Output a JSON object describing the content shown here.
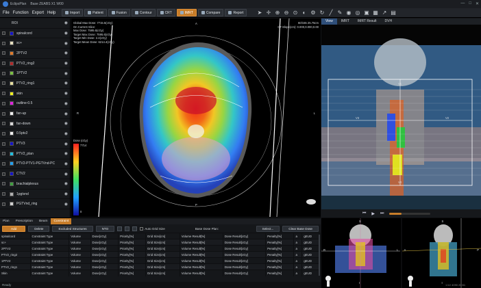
{
  "app": {
    "name": "EclipsPlan",
    "subtitle": "Base  ZEABS X1 W00",
    "window_controls": [
      "—",
      "□",
      "✕"
    ]
  },
  "menu": [
    "File",
    "Function",
    "Export",
    "Help"
  ],
  "toolbar_buttons": [
    {
      "label": "Import",
      "active": false
    },
    {
      "label": "Patient",
      "active": false
    },
    {
      "label": "Fusion",
      "active": false
    },
    {
      "label": "Contour",
      "active": false
    },
    {
      "label": "CRT",
      "active": false
    },
    {
      "label": "IMRT",
      "active": true
    },
    {
      "label": "Compare",
      "active": false
    },
    {
      "label": "Report",
      "active": false
    }
  ],
  "tools": [
    {
      "name": "pointer-icon",
      "glyph": "➤"
    },
    {
      "name": "move-icon",
      "glyph": "✛"
    },
    {
      "name": "zoom-in-icon",
      "glyph": "⊕"
    },
    {
      "name": "zoom-out-icon",
      "glyph": "⊖"
    },
    {
      "name": "zoom-fit-icon",
      "glyph": "⊙"
    },
    {
      "name": "window-level-icon",
      "glyph": "◐"
    },
    {
      "name": "settings-icon",
      "glyph": "⚙"
    },
    {
      "name": "rotate-icon",
      "glyph": "↻"
    },
    {
      "name": "ruler-icon",
      "glyph": "╱"
    },
    {
      "name": "brush-icon",
      "glyph": "✎"
    },
    {
      "name": "dose-icon",
      "glyph": "◉"
    },
    {
      "name": "contour-icon",
      "glyph": "◎"
    },
    {
      "name": "lock-icon",
      "glyph": "▣"
    },
    {
      "name": "camera-icon",
      "glyph": "▦"
    },
    {
      "name": "export-icon",
      "glyph": "↗"
    },
    {
      "name": "screenshot-icon",
      "glyph": "▤"
    }
  ],
  "roi": {
    "header": "ROI",
    "items": [
      {
        "label": "spinalcord",
        "color": "#1414c8"
      },
      {
        "label": "sc+",
        "color": "#e8e0c0"
      },
      {
        "label": "2PTV2",
        "color": "#e07a2a"
      },
      {
        "label": "PTV2_ring2",
        "color": "#b02a2a"
      },
      {
        "label": "1PTV2",
        "color": "#7ac040"
      },
      {
        "label": "PTV2_ring1",
        "color": "#e8e0a0"
      },
      {
        "label": "skin",
        "color": "#f0f020"
      },
      {
        "label": "outline-0.5",
        "color": "#e020e0"
      },
      {
        "label": "fan-up",
        "color": "#f0f0f0"
      },
      {
        "label": "fan-down",
        "color": "#d8d8d8"
      },
      {
        "label": "0.5ptv2",
        "color": "#f0f0f0"
      },
      {
        "label": "PTV3",
        "color": "#1414c8"
      },
      {
        "label": "PTV2_plan",
        "color": "#20c0e0"
      },
      {
        "label": "PTV2-PTV1-PGTVnd-PC",
        "color": "#20a0f0"
      },
      {
        "label": "CTV2",
        "color": "#1414c8"
      },
      {
        "label": "brachialplexus",
        "color": "#40a040"
      },
      {
        "label": "1pgtvnd",
        "color": "#b0b0b0"
      },
      {
        "label": "PGTVnd_ring",
        "color": "#d0d0d0"
      }
    ]
  },
  "axial": {
    "info_left": [
      "Global Max Dose:  7715.5(cGy)",
      "On Current Slice:",
      "Max Dose:  7595.6(cGy)",
      "Target Max Dose:  7595.6(cGy)",
      "Target Min Dose:  2.4(cGy)",
      "Target Mean Dose:  6214.4(cGy)"
    ],
    "info_right": [
      "60/155    25.75cm",
      "CT-Slope(cm): 0.000,0.000,0.00"
    ],
    "orient": {
      "top": "A",
      "left": "R",
      "right": "L",
      "bottom": "P"
    },
    "dose_legend": {
      "title": "Dose (cGy)",
      "max": "7714",
      "min": "0"
    }
  },
  "right_tabs": [
    {
      "label": "View",
      "sel": true
    },
    {
      "label": "IMRT",
      "sel": false
    },
    {
      "label": "IMRT Result",
      "sel": false
    },
    {
      "label": "DVH",
      "sel": false
    }
  ],
  "coronal_labels": {
    "top": "V1",
    "left": "V3",
    "right": "V2",
    "bottom": "V4"
  },
  "thumb_labels": {
    "a_top": "S",
    "a_left": "R",
    "a_right": "L",
    "a_bottom": "I",
    "b_top": "S",
    "b_left": "A",
    "b_right": "P",
    "b_bottom": "I"
  },
  "bottom": {
    "tabs": [
      {
        "label": "Plan",
        "sel": false
      },
      {
        "label": "Prescription",
        "sel": false
      },
      {
        "label": "Beam",
        "sel": false
      },
      {
        "label": "Constraint",
        "sel": true
      }
    ],
    "actions": {
      "add": "Add",
      "delete": "Delete",
      "excluded": "Excluded Structures",
      "nto": "NTO",
      "auto_grid": "Auto Grid Size",
      "base_plan": "Base Dose Plan:",
      "select": "Select...",
      "clear": "Clear Base Dose"
    },
    "rows": [
      [
        "spinalcord",
        "Constraint Type",
        "Volume",
        "Dose[cGy]",
        "Priority[%]",
        "Grid Size[cm]",
        "Volume Result[%]",
        "Dose Result[cGy]",
        "Penalty[%]",
        "a",
        "gEUD"
      ],
      [
        "sc+",
        "Constraint Type",
        "Volume",
        "Dose[cGy]",
        "Priority[%]",
        "Grid Size[cm]",
        "Volume Result[%]",
        "Dose Result[cGy]",
        "Penalty[%]",
        "a",
        "gEUD"
      ],
      [
        "2PTV2",
        "Constraint Type",
        "Volume",
        "Dose[cGy]",
        "Priority[%]",
        "Grid Size[cm]",
        "Volume Result[%]",
        "Dose Result[cGy]",
        "Penalty[%]",
        "a",
        "gEUD"
      ],
      [
        "PTV2_ring2",
        "Constraint Type",
        "Volume",
        "Dose[cGy]",
        "Priority[%]",
        "Grid Size[cm]",
        "Volume Result[%]",
        "Dose Result[cGy]",
        "Penalty[%]",
        "a",
        "gEUD"
      ],
      [
        "1PTV2",
        "Constraint Type",
        "Volume",
        "Dose[cGy]",
        "Priority[%]",
        "Grid Size[cm]",
        "Volume Result[%]",
        "Dose Result[cGy]",
        "Penalty[%]",
        "a",
        "gEUD"
      ],
      [
        "PTV2_ring1",
        "Constraint Type",
        "Volume",
        "Dose[cGy]",
        "Priority[%]",
        "Grid Size[cm]",
        "Volume Result[%]",
        "Dose Result[cGy]",
        "Penalty[%]",
        "a",
        "gEUD"
      ],
      [
        "Skin",
        "Constraint Type",
        "Volume",
        "Dose[cGy]",
        "Priority[%]",
        "Grid Size[cm]",
        "Volume Result[%]",
        "Dose Result[cGy]",
        "Penalty[%]",
        "a",
        "gEUD"
      ]
    ]
  },
  "status": "Ready",
  "status_right": "1 kV   4090   20:51"
}
